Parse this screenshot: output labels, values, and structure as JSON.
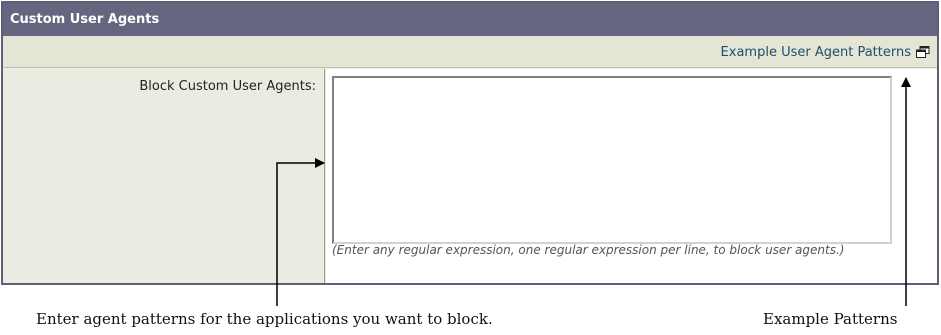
{
  "panel": {
    "title": "Custom User Agents",
    "example_link": "Example User Agent Patterns",
    "field_label": "Block Custom User Agents:",
    "textarea_value": "",
    "hint": "(Enter any regular expression, one regular expression per line, to block user agents.)"
  },
  "icons": {
    "popup": "popup-window-icon"
  },
  "colors": {
    "header_bg": "#666680",
    "header_text": "#ffffff",
    "link": "#1c4f6b",
    "panel_bg": "#ecebe1"
  },
  "callouts": {
    "left_caption": "Enter agent patterns for the applications you want to block.",
    "right_caption": "Example Patterns"
  }
}
